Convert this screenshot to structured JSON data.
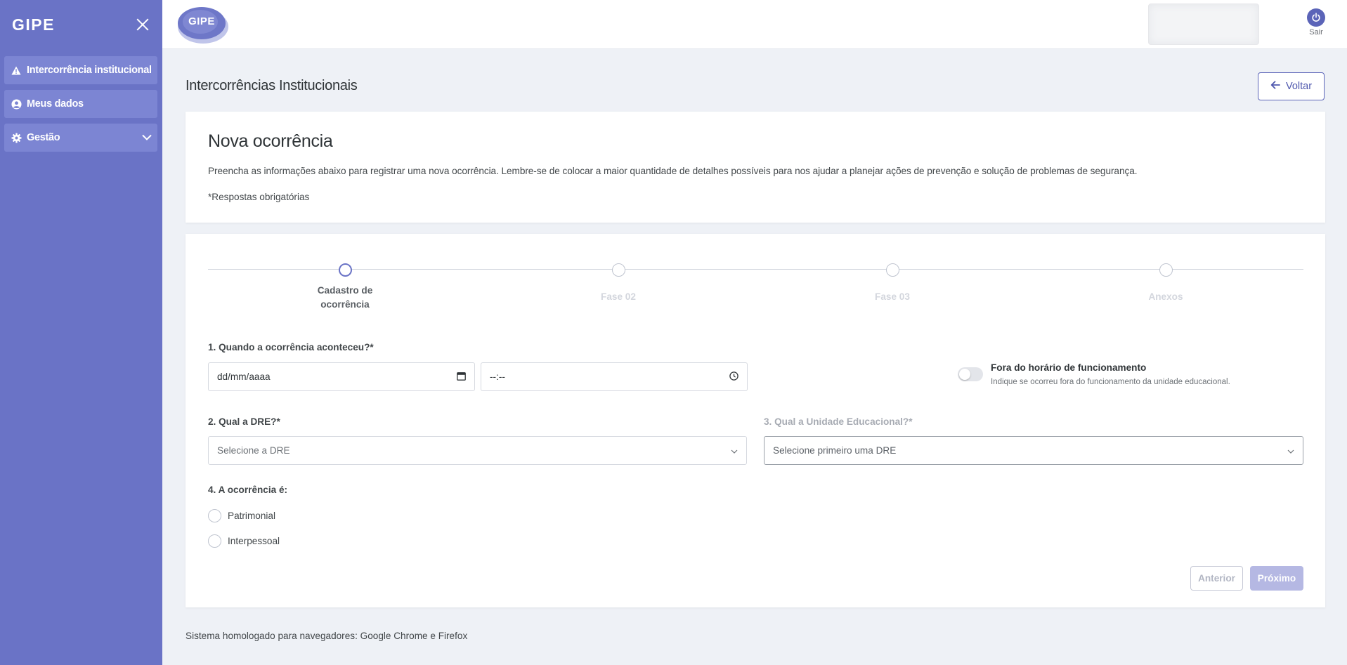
{
  "sidebar": {
    "brand": "GIPE",
    "items": [
      {
        "label": "Intercorrência institucional",
        "icon": "warning-icon"
      },
      {
        "label": "Meus dados",
        "icon": "user-icon"
      },
      {
        "label": "Gestão",
        "icon": "gear-icon"
      }
    ]
  },
  "topbar": {
    "logo_text": "GIPE",
    "logout_label": "Sair"
  },
  "header": {
    "title": "Intercorrências Institucionais",
    "back_label": "Voltar"
  },
  "intro": {
    "title": "Nova ocorrência",
    "description": "Preencha as informações abaixo para registrar uma nova ocorrência. Lembre-se de colocar a maior quantidade de detalhes possíveis para nos ajudar a planejar ações de prevenção e solução de problemas de segurança.",
    "required_note": "*Respostas obrigatórias"
  },
  "stepper": {
    "steps": [
      {
        "label_line1": "Cadastro de",
        "label_line2": "ocorrência",
        "active": true
      },
      {
        "label": "Fase 02",
        "active": false
      },
      {
        "label": "Fase 03",
        "active": false
      },
      {
        "label": "Anexos",
        "active": false
      }
    ]
  },
  "form": {
    "q1": {
      "label": "1. Quando a ocorrência aconteceu?*",
      "date_value": "dd/mm/aaaa",
      "time_value": "--:--"
    },
    "toggle": {
      "title": "Fora do horário de funcionamento",
      "hint": "Indique se ocorreu fora do funcionamento da unidade educacional.",
      "on": false
    },
    "q2": {
      "label": "2. Qual a DRE?*",
      "placeholder": "Selecione a DRE"
    },
    "q3": {
      "label": "3. Qual a Unidade Educacional?*",
      "placeholder": "Selecione primeiro uma DRE"
    },
    "q4": {
      "label": "4. A ocorrência é:",
      "options": [
        "Patrimonial",
        "Interpessoal"
      ]
    },
    "prev_label": "Anterior",
    "next_label": "Próximo"
  },
  "footer": {
    "text": "Sistema homologado para navegadores: Google Chrome e Firefox"
  },
  "colors": {
    "sidebar": "#6a73c6",
    "sidebar_item": "#7c85d3",
    "accent": "#5b64b8",
    "background": "#eef1f6"
  }
}
